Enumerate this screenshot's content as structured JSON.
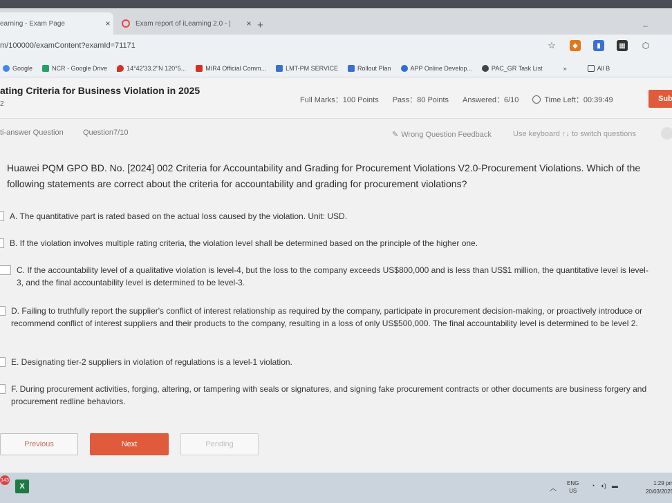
{
  "browser": {
    "tabs": [
      {
        "title": "earning - Exam Page",
        "close": "×"
      },
      {
        "title": "Exam report of iLearning 2.0 - |",
        "close": "×"
      }
    ],
    "new_tab": "+",
    "minimize": "–",
    "url": "m/100000/examContent?examId=71171",
    "bookmarks": [
      {
        "label": "Google",
        "icon": "google-icon",
        "color": "#4285f4"
      },
      {
        "label": "NCR - Google Drive",
        "icon": "drive-icon",
        "color": "#1fa463"
      },
      {
        "label": "14°42'33.2\"N 120°5...",
        "icon": "map-pin-icon",
        "color": "#d93025"
      },
      {
        "label": "MIR4 Official Comm...",
        "icon": "mir4-icon",
        "color": "#d93025"
      },
      {
        "label": "LMT-PM SERVICE",
        "icon": "lmt-icon",
        "color": "#3b6fd8"
      },
      {
        "label": "Rollout Plan",
        "icon": "rollout-icon",
        "color": "#3b6fd8"
      },
      {
        "label": "APP Online Develop...",
        "icon": "cloud-icon",
        "color": "#2a6fd8"
      },
      {
        "label": "PAC_GR Task List",
        "icon": "chrome-icon",
        "color": "#444"
      }
    ],
    "more": "»",
    "all_bookmarks": "All B"
  },
  "exam": {
    "title": "ating Criteria for Business Violation in 2025",
    "subtitle": "2",
    "full_marks": "Full Marks：100 Points",
    "pass": "Pass：80 Points",
    "answered": "Answered：6/10",
    "time_left": "Time Left：00:39:49",
    "submit": "Sub"
  },
  "question_bar": {
    "type": "ti-answer Question",
    "number": "Question7/10",
    "feedback": "Wrong Question Feedback",
    "keyboard_hint": "Use keyboard ↑↓ to switch questions"
  },
  "question": {
    "text": "Huawei PQM GPO BD. No. [2024] 002 Criteria for Accountability and Grading for Procurement Violations V2.0-Procurement Violations. Which of the following statements are correct about the criteria for accountability and grading for procurement violations?",
    "options": [
      "A. The quantitative part is rated based on the actual loss caused by the violation. Unit: USD.",
      "B. If the violation involves multiple rating criteria, the violation level shall be determined based on the principle of the higher one.",
      "C. If the accountability level of a qualitative violation is level-4, but the loss to the company exceeds US$800,000 and is less than US$1 million, the quantitative level is level-3, and the final accountability level is determined to be level-3.",
      "D. Failing to truthfully report the supplier's conflict of interest relationship as required by the company, participate in procurement decision-making, or proactively introduce or recommend conflict of interest suppliers and their products to the company, resulting in a loss of only US$500,000. The final accountability level is determined to be level 2.",
      "E. Designating tier-2 suppliers in violation of regulations is a level-1 violation.",
      "F. During procurement activities, forging, altering, or tampering with seals or signatures, and signing fake procurement contracts or other documents are business forgery and procurement redline behaviors."
    ]
  },
  "buttons": {
    "previous": "Previous",
    "next": "Next",
    "pending": "Pending"
  },
  "taskbar": {
    "badge": "143",
    "lang_top": "ENG",
    "lang_bottom": "US",
    "time": "1:29 pm",
    "date": "20/03/2025"
  },
  "colors": {
    "accent": "#e05a3c"
  }
}
